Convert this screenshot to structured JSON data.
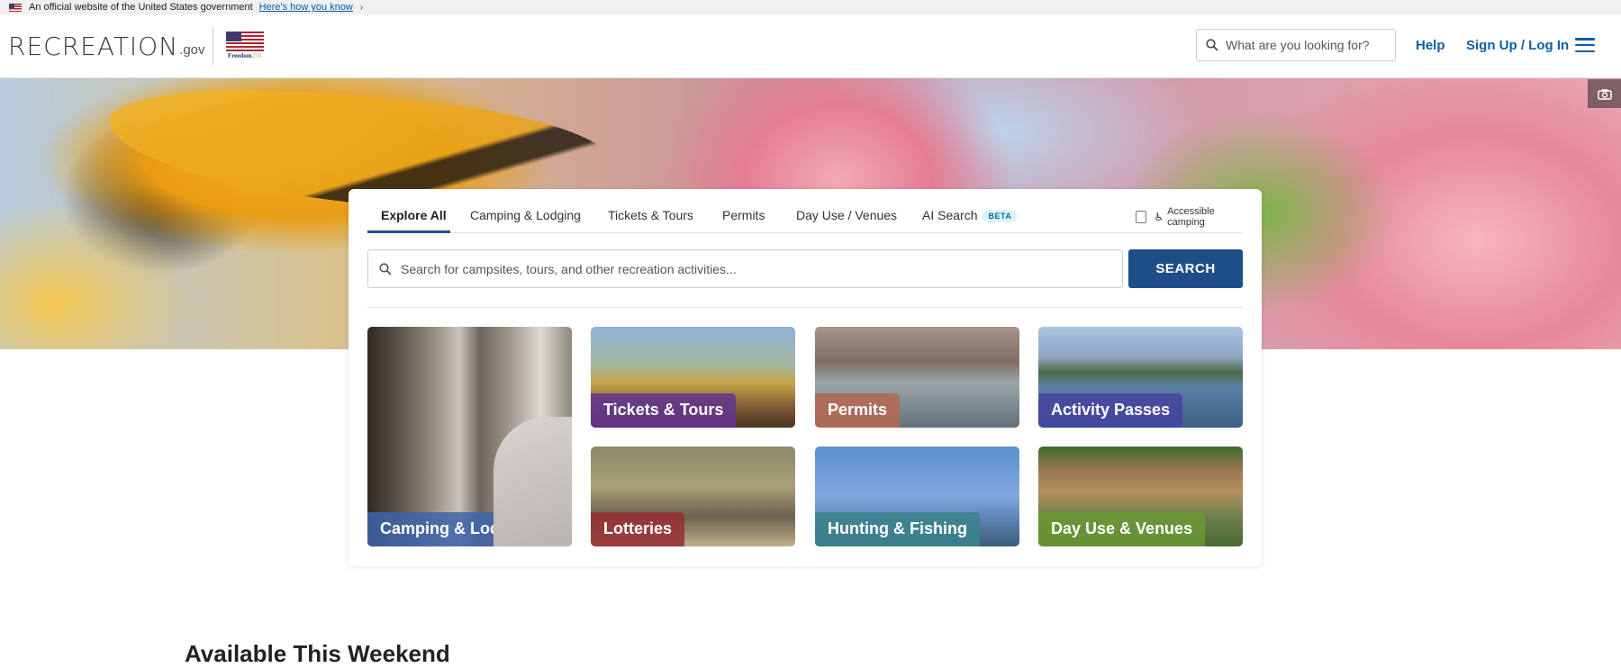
{
  "gov_banner": {
    "text": "An official website of the United States government",
    "link": "Here's how you know",
    "chevron": "›"
  },
  "header": {
    "logo_word": "RECREATION",
    "logo_suffix": ".gov",
    "badge_text_main": "Freedom",
    "badge_text_num": "250",
    "search_placeholder": "What are you looking for?",
    "help": "Help",
    "login": "Sign Up / Log In"
  },
  "hero": {
    "camera_icon": "camera-icon"
  },
  "search_card": {
    "tabs": [
      {
        "label": "Explore All"
      },
      {
        "label": "Camping & Lodging"
      },
      {
        "label": "Tickets & Tours"
      },
      {
        "label": "Permits"
      },
      {
        "label": "Day Use / Venues"
      },
      {
        "label": "AI Search"
      }
    ],
    "active_tab": "Explore All",
    "beta_badge": "BETA",
    "accessible_label": "Accessible camping",
    "search_placeholder": "Search for campsites, tours, and other recreation activities...",
    "search_button": "SEARCH"
  },
  "tiles": [
    {
      "label": "Camping & Lodging",
      "color": "#3e64aa"
    },
    {
      "label": "Tickets & Tours",
      "color": "#62348c"
    },
    {
      "label": "Permits",
      "color": "#b46854"
    },
    {
      "label": "Activity Passes",
      "color": "#4646a0"
    },
    {
      "label": "Lotteries",
      "color": "#963034"
    },
    {
      "label": "Hunting & Fishing",
      "color": "#3c828c"
    },
    {
      "label": "Day Use & Venues",
      "color": "#689634"
    }
  ],
  "section": {
    "heading": "Available This Weekend"
  },
  "colors": {
    "primary": "#1e4e88",
    "link": "#0e5ea5"
  }
}
